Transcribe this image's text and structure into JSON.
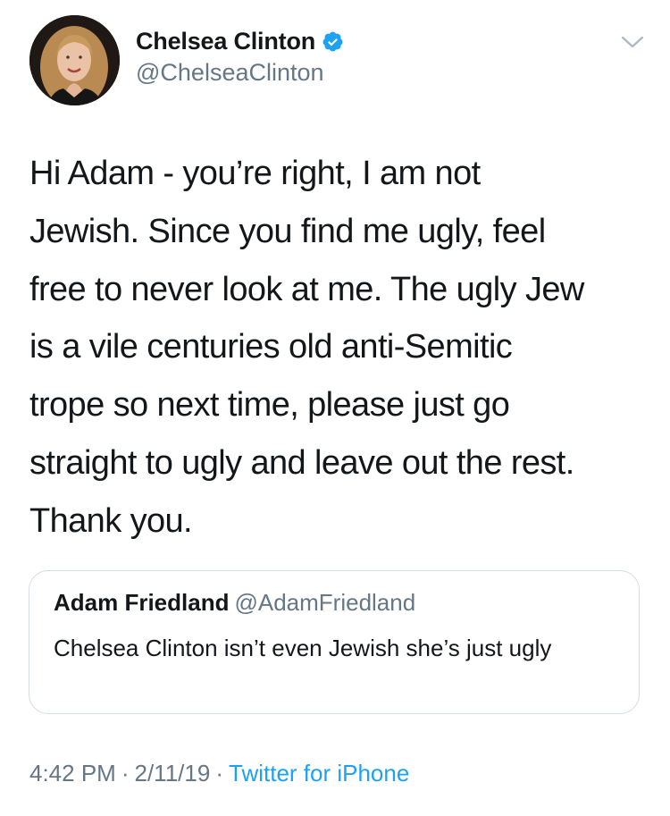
{
  "author": {
    "display_name": "Chelsea Clinton",
    "handle": "@ChelseaClinton",
    "verified_icon": "verified-badge-icon",
    "avatar_icon": "avatar-photo"
  },
  "menu_icon": "chevron-down-icon",
  "tweet": {
    "text": "Hi Adam - you’re right, I am not\nJewish. Since you find me ugly, feel\nfree to never look at me. The ugly Jew\nis a vile centuries old anti-Semitic\ntrope so next time, please just go\nstraight to ugly and leave out the rest.\nThank you."
  },
  "quoted_tweet": {
    "display_name": "Adam Friedland",
    "handle": "@AdamFriedland",
    "text": "Chelsea Clinton isn’t even Jewish she’s just ugly"
  },
  "meta": {
    "time": "4:42 PM",
    "separator": "·",
    "date": "2/11/19",
    "source": "Twitter for iPhone"
  },
  "colors": {
    "text": "#14171a",
    "secondary": "#657786",
    "link": "#1da1f2",
    "border": "#d6dde2"
  }
}
